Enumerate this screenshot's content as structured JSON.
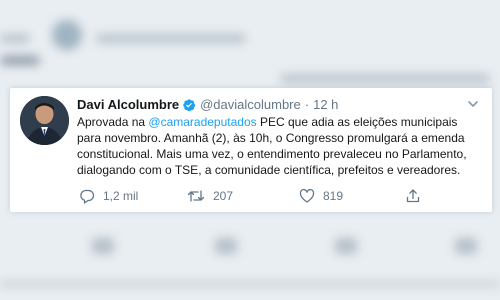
{
  "tweet": {
    "author_name": "Davi Alcolumbre",
    "handle": "@davialcolumbre",
    "separator": "·",
    "time": "12 h",
    "text_before_mention": "Aprovada na ",
    "mention": "@camaradeputados",
    "text_after_mention": " PEC que adia as eleições municipais para novembro. Amanhã (2), às 10h, o Congresso promulgará a emenda constitucional. Mais uma vez, o entendimento prevaleceu no Parlamento, dialogando com o TSE, a comunidade científica, prefeitos e vereadores.",
    "replies": "1,2 mil",
    "retweets": "207",
    "likes": "819"
  },
  "icons": {
    "verified": "verified-badge-icon",
    "menu": "chevron-down-icon",
    "reply": "reply-icon",
    "retweet": "retweet-icon",
    "like": "heart-icon",
    "share": "share-icon"
  },
  "colors": {
    "link": "#1da1f2",
    "text": "#14171a",
    "muted": "#657786",
    "background": "#e9eef2"
  }
}
